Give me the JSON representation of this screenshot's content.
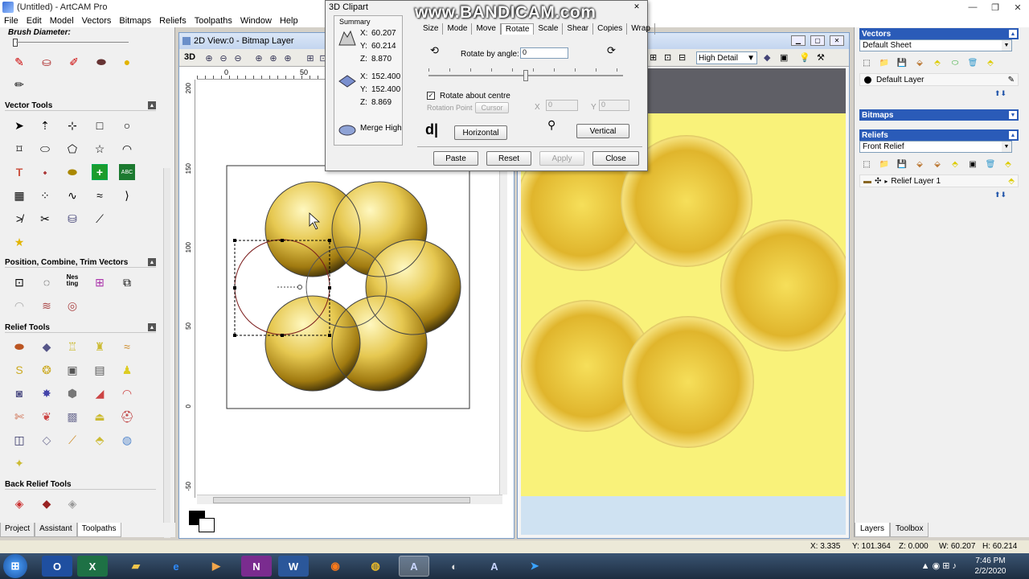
{
  "window": {
    "title": "(Untitled) - ArtCAM Pro",
    "minimize": "—",
    "restore": "❐",
    "close": "✕"
  },
  "menu": [
    "File",
    "Edit",
    "Model",
    "Vectors",
    "Bitmaps",
    "Reliefs",
    "Toolpaths",
    "Window",
    "Help"
  ],
  "left_panel": {
    "brush_label": "Brush Diameter:",
    "sections": {
      "vector_tools": "Vector Tools",
      "position_tools": "Position, Combine, Trim Vectors",
      "relief_tools": "Relief Tools",
      "back_relief_tools": "Back Relief Tools"
    },
    "nesting_label": "Nes ting",
    "abc_label": "ABC",
    "tabs": [
      "Project",
      "Assistant",
      "Toolpaths"
    ]
  },
  "view2d": {
    "title": "2D View:0 - Bitmap Layer",
    "label_3d": "3D",
    "ruler_h": [
      "0",
      "50"
    ],
    "ruler_v": [
      "200",
      "150",
      "100",
      "50",
      "0",
      "-50"
    ]
  },
  "view3d": {
    "detail_selected": "High Detail",
    "colors": {
      "sky": "#5f5f66",
      "board": "#f9f27a",
      "floor": "#cfe2f2",
      "disk": "#e0b52c"
    }
  },
  "dialog": {
    "title": "3D Clipart",
    "summary_label": "Summary",
    "summary_top": {
      "x": "60.207",
      "y": "60.214",
      "z": "8.870"
    },
    "summary_bottom": {
      "x": "152.400",
      "y": "152.400",
      "z": "8.869"
    },
    "merge_label": "Merge High",
    "tabs": [
      "Size",
      "Mode",
      "Move",
      "Rotate",
      "Scale",
      "Shear",
      "Copies",
      "Wrap"
    ],
    "active_tab": "Rotate",
    "rotate_by_angle_label": "Rotate by angle:",
    "rotate_angle_value": "0",
    "rotate_about_centre_label": "Rotate about centre",
    "rotation_point_label": "Rotation Point",
    "cursor_label": "Cursor",
    "x_label": "X",
    "y_label": "Y",
    "rp_x_value": "0",
    "rp_y_value": "0",
    "horizontal_label": "Horizontal",
    "vertical_label": "Vertical",
    "paste_label": "Paste",
    "reset_label": "Reset",
    "apply_label": "Apply",
    "close_label": "Close"
  },
  "watermark": "www.BANDICAM.com",
  "right_panel": {
    "vectors_head": "Vectors",
    "vectors_sheet": "Default Sheet",
    "vectors_layer": "Default Layer",
    "bitmaps_head": "Bitmaps",
    "reliefs_head": "Reliefs",
    "reliefs_select": "Front Relief",
    "relief_layer": "Relief Layer 1",
    "tabs": [
      "Layers",
      "Toolbox"
    ]
  },
  "status": {
    "x": "X: 3.335",
    "y": "Y: 101.364",
    "z": "Z: 0.000",
    "w": "W: 60.207",
    "h": "H: 60.214"
  },
  "taskbar": {
    "time": "7:46 PM",
    "date": "2/2/2020"
  }
}
